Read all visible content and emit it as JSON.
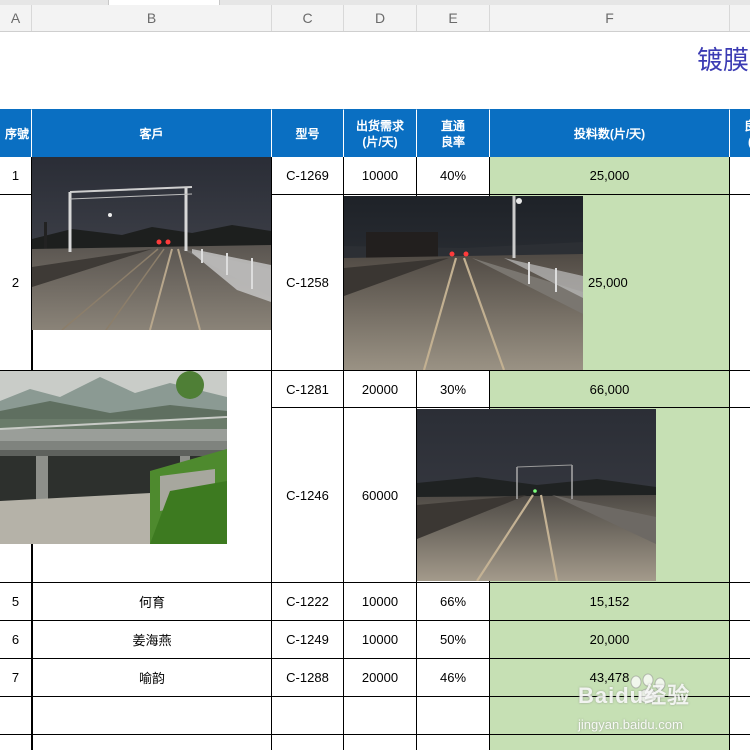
{
  "sheet": {
    "title": "镀膜",
    "column_letters": [
      "A",
      "B",
      "C",
      "D",
      "E",
      "F"
    ]
  },
  "table": {
    "headers": {
      "seq": "序號",
      "customer": "客戶",
      "model": "型号",
      "demand": "出货需求\n(片/天)",
      "yield": "直通\n良率",
      "input": "投料数(片/天)",
      "next": "良\n("
    },
    "rows": [
      {
        "seq": "1",
        "customer": "",
        "model": "C-1269",
        "demand": "10000",
        "yield": "40%",
        "input": "25,000"
      },
      {
        "seq": "2",
        "customer": "",
        "model": "C-1258",
        "demand": "",
        "yield": "",
        "input": "25,000"
      },
      {
        "seq": "",
        "customer": "",
        "model": "C-1281",
        "demand": "20000",
        "yield": "30%",
        "input": "66,000"
      },
      {
        "seq": "",
        "customer": "",
        "model": "C-1246",
        "demand": "60000",
        "yield": "",
        "input": ""
      },
      {
        "seq": "5",
        "customer": "何育",
        "model": "C-1222",
        "demand": "10000",
        "yield": "66%",
        "input": "15,152"
      },
      {
        "seq": "6",
        "customer": "姜海燕",
        "model": "C-1249",
        "demand": "10000",
        "yield": "50%",
        "input": "20,000"
      },
      {
        "seq": "7",
        "customer": "喻韵",
        "model": "C-1288",
        "demand": "20000",
        "yield": "46%",
        "input": "43,478"
      },
      {
        "seq": "",
        "customer": "",
        "model": "",
        "demand": "",
        "yield": "",
        "input": ""
      }
    ]
  },
  "watermark": {
    "brand": "Baidu经验",
    "url": "jingyan.baidu.com"
  }
}
